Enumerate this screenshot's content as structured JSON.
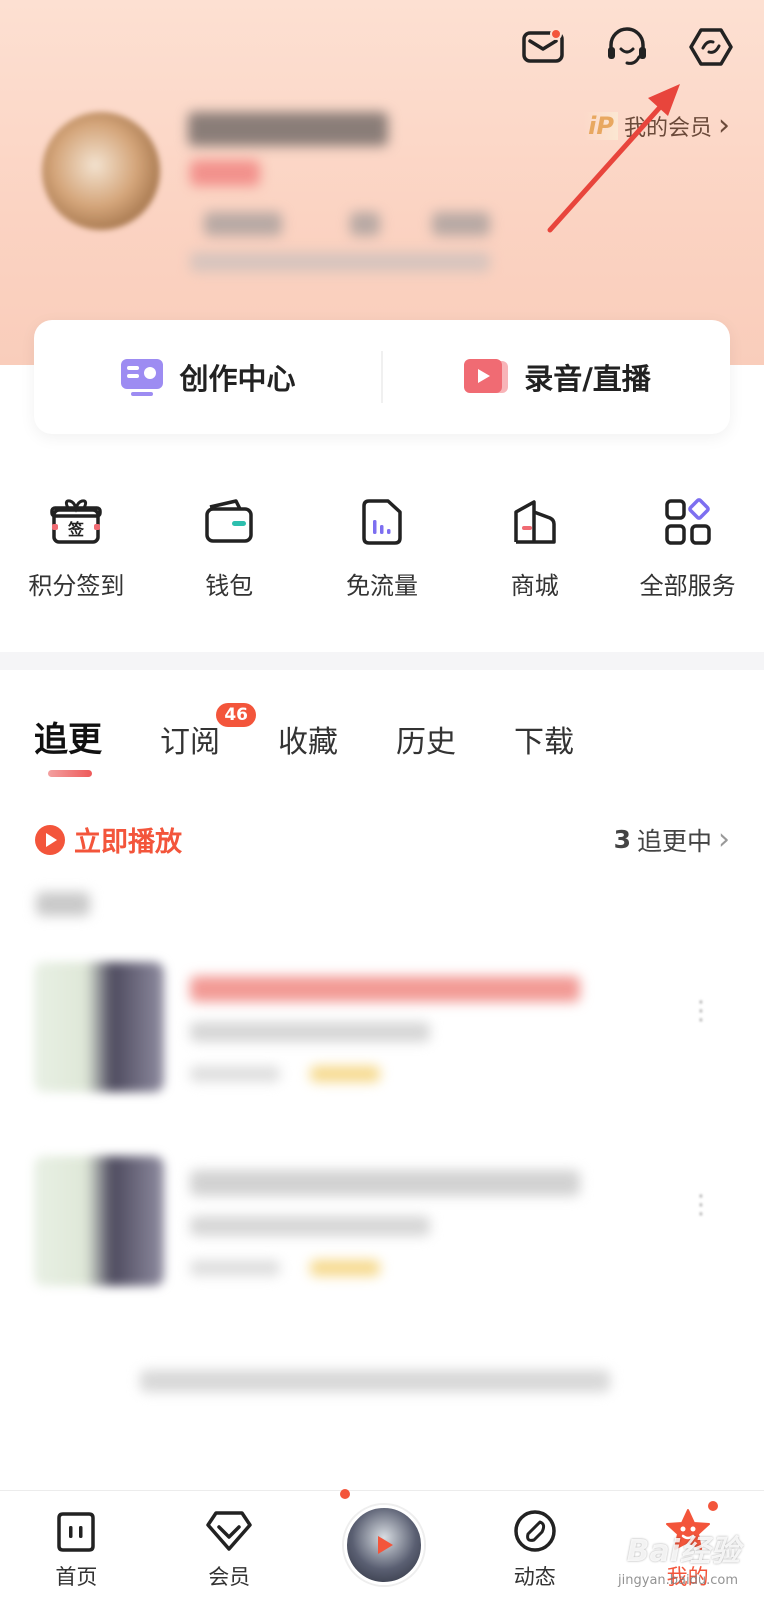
{
  "colors": {
    "accent": "#f3553b",
    "hero_bg": "#fde0d2",
    "vip_gold": "#e8a860"
  },
  "header": {
    "icons": [
      "mail-icon",
      "customer-service-icon",
      "settings-icon"
    ],
    "vip_badge": "iP",
    "vip_link": "我的会员",
    "vip_chevron": "›"
  },
  "creator_card": {
    "left_label": "创作中心",
    "right_label": "录音/直播"
  },
  "services": [
    {
      "label": "积分签到",
      "icon": "checkin-gift-icon",
      "icon_text": "签"
    },
    {
      "label": "钱包",
      "icon": "wallet-icon"
    },
    {
      "label": "免流量",
      "icon": "free-data-icon"
    },
    {
      "label": "商城",
      "icon": "mall-icon"
    },
    {
      "label": "全部服务",
      "icon": "all-services-icon"
    }
  ],
  "tabs": [
    {
      "label": "追更",
      "active": true
    },
    {
      "label": "订阅",
      "badge": "46"
    },
    {
      "label": "收藏"
    },
    {
      "label": "历史"
    },
    {
      "label": "下载"
    }
  ],
  "play_row": {
    "play_label": "立即播放",
    "following_count": "3",
    "following_label": "追更中",
    "chevron": "›"
  },
  "bottom_nav": [
    {
      "label": "首页",
      "icon": "home-icon"
    },
    {
      "label": "会员",
      "icon": "vip-diamond-icon"
    },
    {
      "label": "",
      "icon": "now-playing-icon"
    },
    {
      "label": "动态",
      "icon": "discover-icon"
    },
    {
      "label": "我的",
      "icon": "profile-star-icon",
      "active": true
    }
  ],
  "watermark": {
    "main": "Bai经验",
    "sub": "jingyan.baidu.com"
  }
}
